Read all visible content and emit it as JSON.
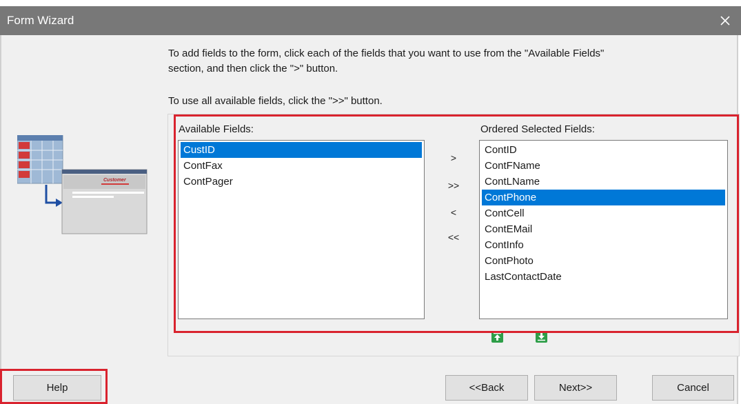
{
  "window": {
    "title": "Form Wizard",
    "close_icon": "close-icon"
  },
  "instructions": {
    "line1": "To add fields to the form, click each of the fields that you want to use from the \"Available Fields\"",
    "line2": "section, and then click the \">\" button.",
    "line3": "To use all available fields, click the \">>\" button."
  },
  "available": {
    "label": "Available Fields:",
    "items": [
      "CustID",
      "ContFax",
      "ContPager"
    ],
    "selected": "CustID"
  },
  "selected_fields": {
    "label": "Ordered Selected Fields:",
    "items": [
      "ContID",
      "ContFName",
      "ContLName",
      "ContPhone",
      "ContCell",
      "ContEMail",
      "ContInfo",
      "ContPhoto",
      "LastContactDate"
    ],
    "selected": "ContPhone"
  },
  "move_buttons": {
    "add": ">",
    "add_all": ">>",
    "remove": "<",
    "remove_all": "<<"
  },
  "order_buttons": {
    "up_icon": "arrow-up-icon",
    "down_icon": "arrow-down-icon"
  },
  "preview": {
    "caption": "Customer"
  },
  "footer": {
    "help": "Help",
    "back": "<<Back",
    "next": "Next>>",
    "cancel": "Cancel"
  },
  "colors": {
    "highlight": "#d9232e",
    "selection": "#0078d7",
    "titlebar": "#787878",
    "order_green": "#2e9e48"
  }
}
